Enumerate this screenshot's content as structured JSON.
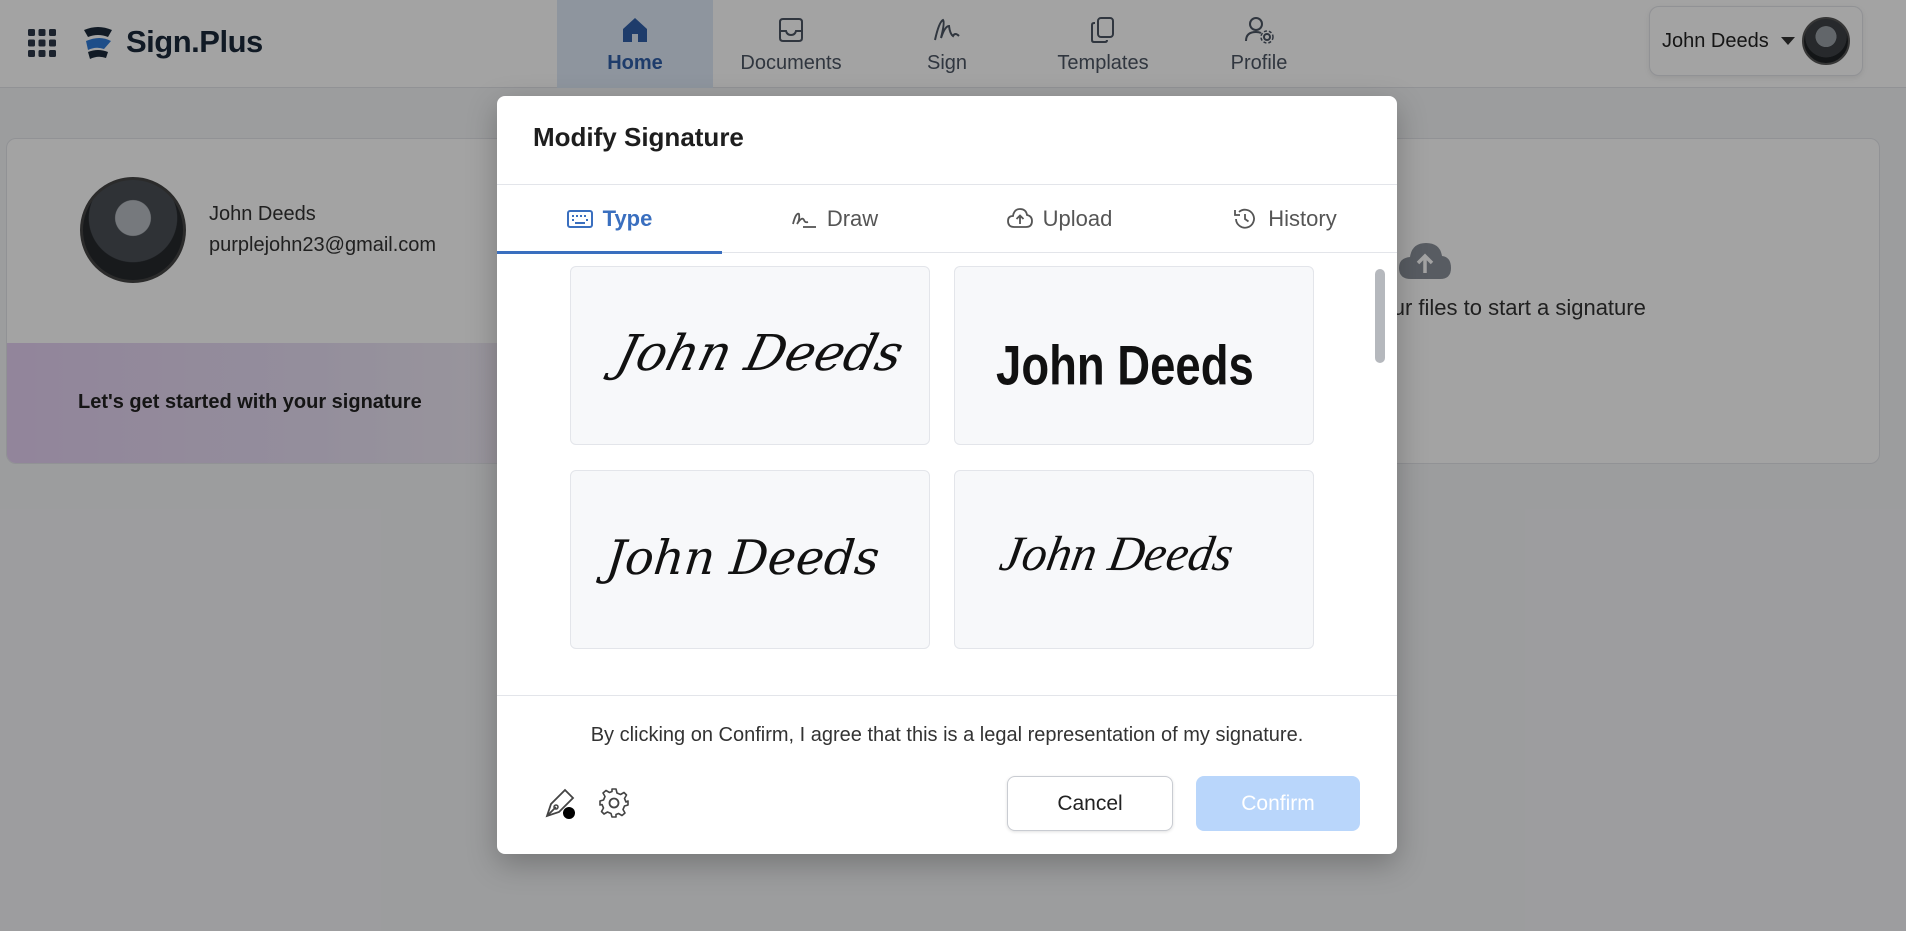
{
  "app": {
    "brand": "Sign.Plus"
  },
  "nav": {
    "items": [
      {
        "label": "Home",
        "icon": "home-icon",
        "active": true
      },
      {
        "label": "Documents",
        "icon": "inbox-icon",
        "active": false
      },
      {
        "label": "Sign",
        "icon": "signature-icon",
        "active": false
      },
      {
        "label": "Templates",
        "icon": "copy-icon",
        "active": false
      },
      {
        "label": "Profile",
        "icon": "user-gear-icon",
        "active": false
      }
    ]
  },
  "user": {
    "name": "John Deeds",
    "email": "purplejohn23@gmail.com"
  },
  "banner": {
    "text": "Let's get started with your signature"
  },
  "dropzone": {
    "text": "d drop your files to start a signature"
  },
  "modal": {
    "title": "Modify Signature",
    "tabs": [
      {
        "label": "Type",
        "icon": "keyboard-icon",
        "active": true
      },
      {
        "label": "Draw",
        "icon": "draw-icon",
        "active": false
      },
      {
        "label": "Upload",
        "icon": "cloud-upload-icon",
        "active": false
      },
      {
        "label": "History",
        "icon": "history-icon",
        "active": false
      }
    ],
    "signatures": [
      {
        "text": "John Deeds",
        "style": "slanted-script"
      },
      {
        "text": "John Deeds",
        "style": "bold-marker"
      },
      {
        "text": "John Deeds",
        "style": "flowing-script"
      },
      {
        "text": "John Deeds",
        "style": "calligraphy"
      }
    ],
    "legal_text": "By clicking on Confirm, I agree that this is a legal representation of my signature.",
    "cancel_label": "Cancel",
    "confirm_label": "Confirm"
  },
  "colors": {
    "accent": "#3a6fbf",
    "nav_active_bg": "#dfe9f7",
    "confirm_disabled": "#b9d6fb"
  }
}
